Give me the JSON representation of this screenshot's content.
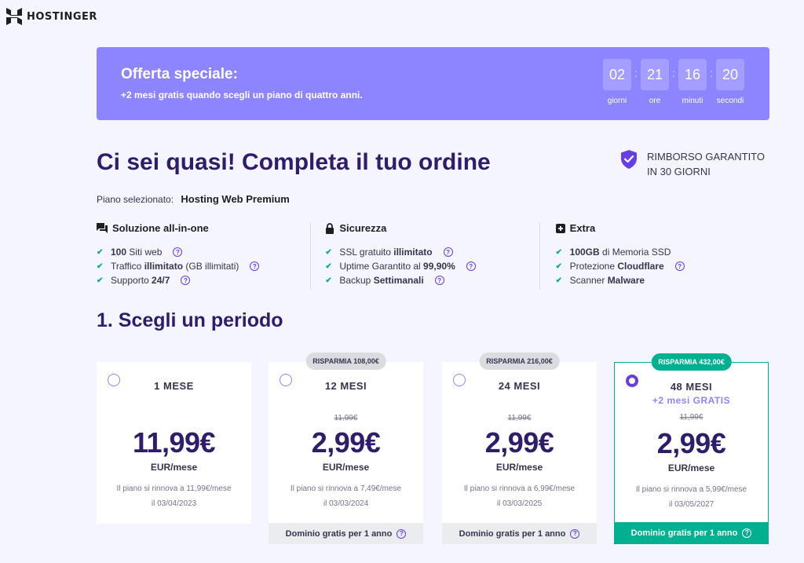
{
  "logo": {
    "text": "HOSTINGER"
  },
  "promo": {
    "title": "Offerta speciale:",
    "subtitle": "+2 mesi gratis quando scegli un piano di quattro anni.",
    "countdown": [
      {
        "value": "02",
        "label": "giorni"
      },
      {
        "value": "21",
        "label": "ore"
      },
      {
        "value": "16",
        "label": "minuti"
      },
      {
        "value": "20",
        "label": "secondi"
      }
    ]
  },
  "headline": "Ci sei quasi! Completa il tuo ordine",
  "guarantee": {
    "line1": "RIMBORSO GARANTITO",
    "line2": "IN 30 GIORNI"
  },
  "selected_plan": {
    "label": "Piano selezionato:",
    "name": "Hosting Web Premium"
  },
  "features": [
    {
      "title": "Soluzione all-in-one",
      "icon": "chat-icon",
      "items": [
        {
          "bold": "100",
          "text": " Siti web",
          "help": true
        },
        {
          "pre": "Traffico ",
          "bold": "illimitato",
          "text": " (GB illimitati)",
          "help": true
        },
        {
          "pre": "Supporto ",
          "bold": "24/7",
          "text": "",
          "help": true
        }
      ]
    },
    {
      "title": "Sicurezza",
      "icon": "lock-icon",
      "items": [
        {
          "pre": "SSL gratuito ",
          "bold": "illimitato",
          "text": "",
          "help": true
        },
        {
          "pre": "Uptime Garantito al ",
          "bold": "99,90%",
          "text": "",
          "help": true
        },
        {
          "pre": "Backup ",
          "bold": "Settimanali",
          "text": "",
          "help": true
        }
      ]
    },
    {
      "title": "Extra",
      "icon": "plus-box-icon",
      "items": [
        {
          "bold": "100GB",
          "text": " di Memoria SSD",
          "help": false
        },
        {
          "pre": "Protezione ",
          "bold": "Cloudflare",
          "text": "",
          "help": true
        },
        {
          "pre": "Scanner ",
          "bold": "Malware",
          "text": "",
          "help": false
        }
      ]
    }
  ],
  "period_section": {
    "title": "1. Scegli un periodo"
  },
  "plans": [
    {
      "period": "1 MESE",
      "price": "11,99€",
      "unit": "EUR/mese",
      "renew_line1": "Il piano si rinnova a 11,99€/mese",
      "renew_line2": "il 03/04/2023"
    },
    {
      "badge": "RISPARMIA 108,00€",
      "period": "12 MESI",
      "old_price": "11,99€",
      "price": "2,99€",
      "unit": "EUR/mese",
      "renew_line1": "Il piano si rinnova a 7,49€/mese",
      "renew_line2": "il 03/03/2024",
      "footer": "Dominio gratis per 1 anno"
    },
    {
      "badge": "RISPARMIA 216,00€",
      "period": "24 MESI",
      "old_price": "11,99€",
      "price": "2,99€",
      "unit": "EUR/mese",
      "renew_line1": "Il piano si rinnova a 6,99€/mese",
      "renew_line2": "il 03/03/2025",
      "footer": "Dominio gratis per 1 anno"
    },
    {
      "badge": "RISPARMIA 432,00€",
      "period": "48 MESI",
      "bonus": "+2 mesi GRATIS",
      "old_price": "11,99€",
      "price": "2,99€",
      "unit": "EUR/mese",
      "renew_line1": "Il piano si rinnova a 5,99€/mese",
      "renew_line2": "il 03/05/2027",
      "footer": "Dominio gratis per 1 anno",
      "selected": true
    }
  ],
  "colors": {
    "accent": "#673de6",
    "promo_bg": "#8c85ff",
    "heading": "#2f1c6a",
    "success": "#00b090"
  }
}
